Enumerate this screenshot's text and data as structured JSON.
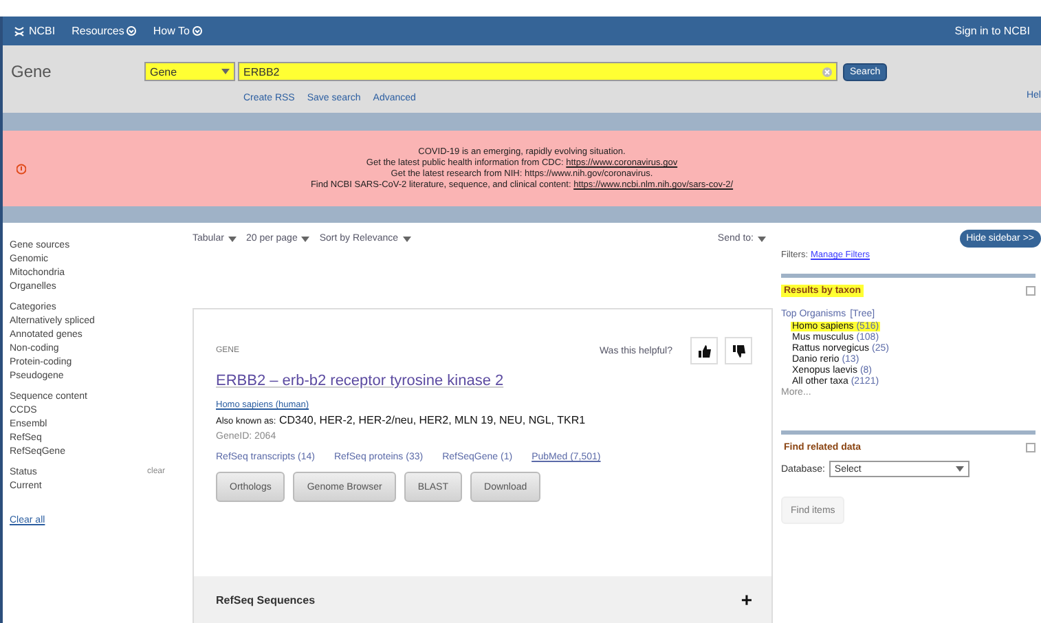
{
  "topbar": {
    "logo": "NCBI",
    "menus": [
      "Resources",
      "How To"
    ],
    "sign_in": "Sign in to NCBI"
  },
  "search": {
    "title": "Gene",
    "database": {
      "value": "Gene",
      "highlighted": true
    },
    "query": {
      "value": "ERBB2",
      "highlighted": true
    },
    "button": "Search",
    "links": [
      "Create RSS",
      "Save search",
      "Advanced"
    ],
    "help": "Hel"
  },
  "alert": {
    "lines": [
      {
        "text": "COVID-19 is an emerging, rapidly evolving situation."
      },
      {
        "text": "Get the latest public health information from CDC: ",
        "link": "https://www.coronavirus.gov"
      },
      {
        "text": "Get the latest research from NIH: https://www.nih.gov/coronavirus."
      },
      {
        "text": "Find NCBI SARS-CoV-2 literature, sequence, and clinical content: ",
        "link": "https://www.ncbi.nlm.nih.gov/sars-cov-2/"
      }
    ]
  },
  "filters": {
    "groups": [
      {
        "title": "Gene sources",
        "items": [
          "Genomic",
          "Mitochondria",
          "Organelles"
        ]
      },
      {
        "title": "Categories",
        "items": [
          "Alternatively spliced",
          "Annotated genes",
          "Non-coding",
          "Protein-coding",
          "Pseudogene"
        ]
      },
      {
        "title": "Sequence content",
        "items": [
          "CCDS",
          "Ensembl",
          "RefSeq",
          "RefSeqGene"
        ]
      },
      {
        "title": "Status",
        "clear": "clear",
        "items": [
          "Current"
        ]
      }
    ],
    "clear_all": "Clear all"
  },
  "toolbar": {
    "options": [
      "Tabular",
      "20 per page",
      "Sort by Relevance"
    ],
    "send_to": "Send to:"
  },
  "result": {
    "type": "GENE",
    "feedback": "Was this helpful?",
    "title": "ERBB2 – erb-b2 receptor tyrosine kinase 2",
    "organism": "Homo sapiens (human)",
    "aka_label": "Also known as:",
    "aka": "CD340, HER-2, HER-2/neu, HER2, MLN 19, NEU, NGL, TKR1",
    "gene_id": "GeneID: 2064",
    "links": [
      "RefSeq transcripts (14)",
      "RefSeq proteins (33)",
      "RefSeqGene (1)",
      "PubMed (7,501)"
    ],
    "buttons": [
      "Orthologs",
      "Genome Browser",
      "BLAST",
      "Download"
    ],
    "section": "RefSeq Sequences",
    "section_toggle": "+"
  },
  "sidebar": {
    "hide": "Hide sidebar >>",
    "filters_label": "Filters:",
    "manage": "Manage Filters",
    "taxon": {
      "title": "Results by taxon",
      "highlighted": true,
      "heading": "Top Organisms",
      "tree": "[Tree]",
      "items": [
        {
          "name": "Homo sapiens",
          "count": "(516)",
          "highlighted": true
        },
        {
          "name": "Mus musculus",
          "count": "(108)",
          "highlighted": false
        },
        {
          "name": "Rattus norvegicus",
          "count": "(25)",
          "highlighted": false
        },
        {
          "name": "Danio rerio",
          "count": "(13)",
          "highlighted": false
        },
        {
          "name": "Xenopus laevis",
          "count": "(8)",
          "highlighted": false
        },
        {
          "name": "All other taxa",
          "count": "(2121)",
          "highlighted": false
        }
      ],
      "more": "More..."
    },
    "related": {
      "title": "Find related data",
      "db_label": "Database:",
      "db_value": "Select",
      "button": "Find items",
      "disabled": true
    }
  }
}
